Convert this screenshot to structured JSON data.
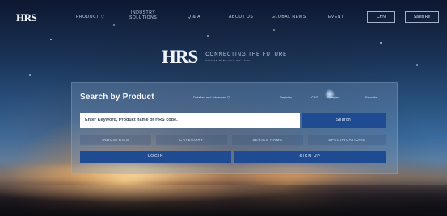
{
  "nav": {
    "logo": "HRS",
    "items": [
      {
        "label": "PRODUCT ▽"
      },
      {
        "label_line1": "INDUSTRY",
        "label_line2": "SOLUTIONS"
      },
      {
        "label": "Q & A"
      },
      {
        "label": "ABOUT US"
      },
      {
        "label": "GLOBAL NEWS"
      },
      {
        "label": "EVENT"
      }
    ],
    "lang_buttons": [
      {
        "label": "CHN"
      },
      {
        "label": "Sales Re"
      }
    ]
  },
  "brand": {
    "logo": "HRS",
    "tagline": "CONNECTING THE FUTURE",
    "sub_tagline": "HIROSE ELECTRIC CO., LTD."
  },
  "search": {
    "title": "Search by Product",
    "links": [
      {
        "label": "Detailed and Advanced ▽"
      },
      {
        "label": "Register"
      },
      {
        "label": "CAD"
      },
      {
        "label": "Samples"
      },
      {
        "label": "Favorite"
      }
    ],
    "input_placeholder": "Enter Keyword, Product name or HRS code.",
    "search_button": "Search",
    "tabs": [
      {
        "label": "INDUSTRIES"
      },
      {
        "label": "CATEGORY"
      },
      {
        "label": "SERIES NAME"
      },
      {
        "label": "SPECIFICATIONS"
      }
    ],
    "login_button": "LOGIN",
    "signup_button": "SIGN UP"
  },
  "colors": {
    "accent": "#1f4b92",
    "panel": "#78a0c8"
  }
}
